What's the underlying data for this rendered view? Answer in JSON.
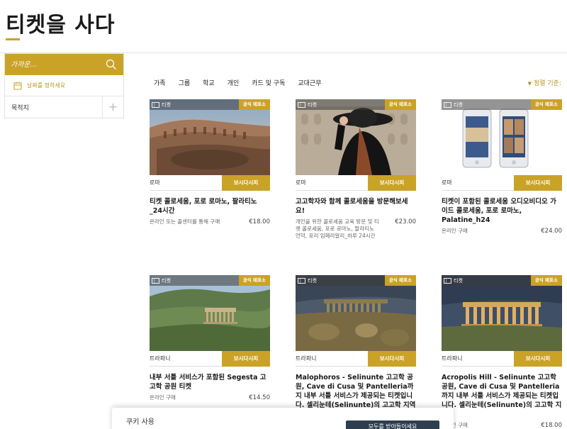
{
  "page": {
    "title": "티켓을 사다"
  },
  "sidebar": {
    "search_placeholder": "가까운...",
    "date_label": "날짜를 정하세요",
    "destination_label": "목적지",
    "destination_plus": "+"
  },
  "tabs": [
    "가족",
    "그룹",
    "학교",
    "개인",
    "카드 및 구독",
    "교대근무"
  ],
  "sort_label": "정렬 기준:",
  "cards": [
    {
      "tag": "티켓",
      "badge": "공식 매표소",
      "city": "로마",
      "button": "보시다시피",
      "title": "티켓 콜로세움, 포로 로마노, 팔라티노 _24시간",
      "desc": "온라인 또는 콜센터를 통해 구매",
      "price": "€18.00"
    },
    {
      "tag": "티켓",
      "badge": "공식 매표소",
      "city": "로마",
      "button": "보시다시피",
      "title": "고고학자와 함께 콜로세움을 방문해보세요!",
      "desc": "개인을 위한 콜로세움 교육 방문 및 티켓 콜로세움, 포로 로마노, 팔라티노 언덕, 포리 임페리알리_하루 24시간",
      "price": "€23.00"
    },
    {
      "tag": "티켓",
      "badge": "공식 매표소",
      "city": "로마",
      "button": "보시다시피",
      "title": "티켓이 포함된 콜로세움 오디오비디오 가이드 콜로세움, 포로 로마노, Palatine_h24",
      "desc": "온라인 구매",
      "price": "€24.00"
    },
    {
      "tag": "티켓",
      "badge": "공식 매표소",
      "city": "트라파니",
      "button": "보시다시피",
      "title": "내부 서틀 서비스가 포함된 Segesta 고고학 공원 티켓",
      "desc": "온라인 구매",
      "price": "€14.50"
    },
    {
      "tag": "티켓",
      "badge": "공식 매표소",
      "city": "트라파니",
      "button": "보시다시피",
      "title": "Malophoros - Selinunte 고고학 공원, Cave di Cusa 및 Pantelleria까지 내부 서틀 서비스가 제공되는 티켓입니다. 셀리눈테(Selinunte)의 고고학 지역",
      "desc": "",
      "price": ""
    },
    {
      "tag": "티켓",
      "badge": "공식 매표소",
      "city": "트라파니",
      "button": "보시다시피",
      "title": "Acropolis Hill - Selinunte 고고학 공원, Cave di Cusa 및 Pantelleria까지 내부 서틀 서비스가 제공되는 티켓입니다. 셀리눈테(Selinunte)의 고고학 지역",
      "desc": "온라인 구매",
      "price": "€18.00"
    }
  ],
  "cookie": {
    "label": "쿠키 사용",
    "button": "모두를 받아들이세요"
  },
  "colors": {
    "accent": "#c9a227",
    "dark_button": "#2e3e4e"
  }
}
